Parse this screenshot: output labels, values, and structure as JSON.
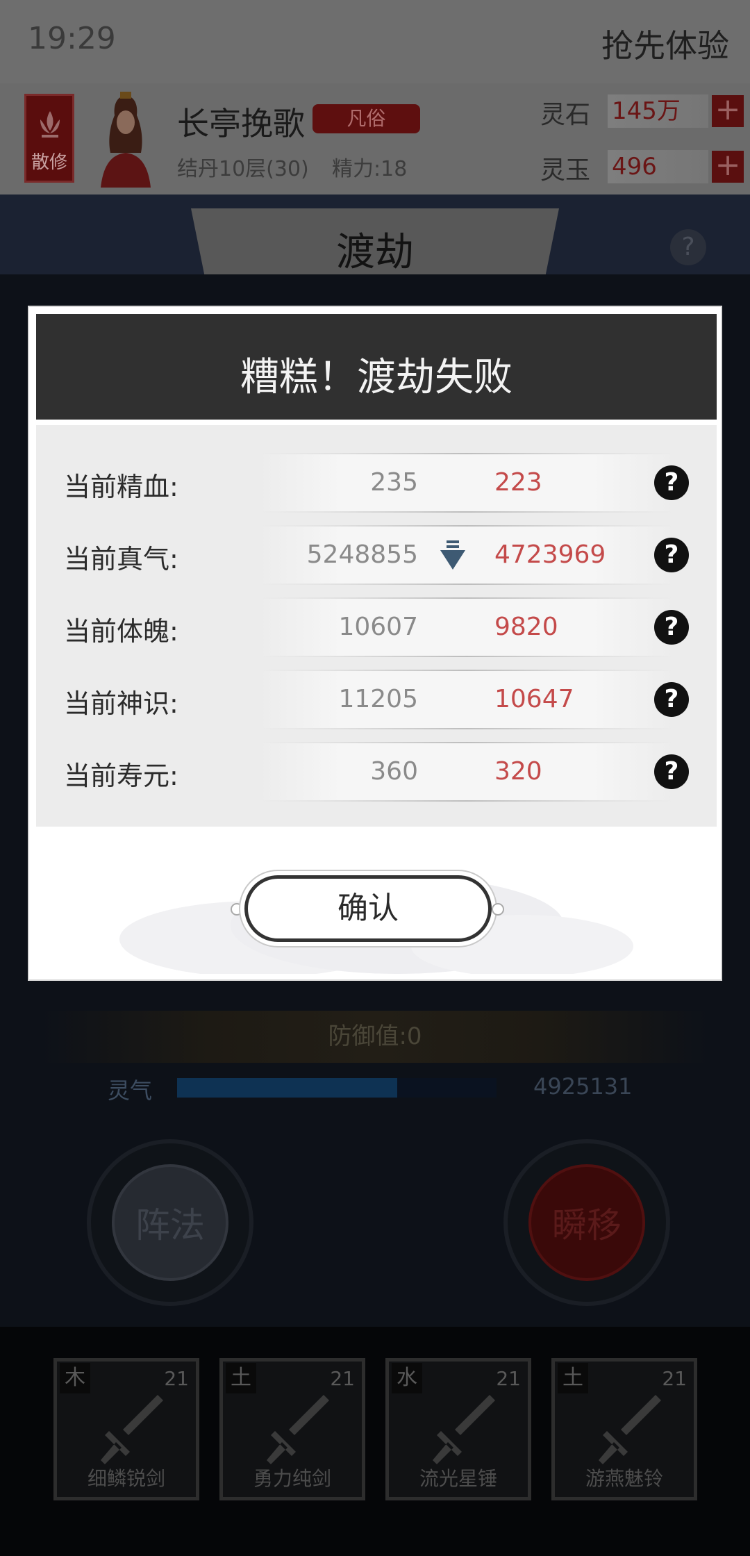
{
  "status_bar": {
    "time": "19:29",
    "early_access": "抢先体验"
  },
  "player": {
    "sect_label": "散修",
    "name": "长亭挽歌",
    "rank": "凡俗",
    "realm": "结丹10层(30)",
    "energy": "精力:18"
  },
  "resources": [
    {
      "label": "灵石",
      "value": "145万",
      "plus": "+"
    },
    {
      "label": "灵玉",
      "value": "496",
      "plus": "+"
    }
  ],
  "page": {
    "title": "渡劫",
    "help": "?"
  },
  "dialog": {
    "title": "糟糕！渡劫失败",
    "stats": [
      {
        "label": "当前精血:",
        "old": "235",
        "new": "223",
        "help": "?"
      },
      {
        "label": "当前真气:",
        "old": "5248855",
        "new": "4723969",
        "help": "?"
      },
      {
        "label": "当前体魄:",
        "old": "10607",
        "new": "9820",
        "help": "?"
      },
      {
        "label": "当前神识:",
        "old": "11205",
        "new": "10647",
        "help": "?"
      },
      {
        "label": "当前寿元:",
        "old": "360",
        "new": "320",
        "help": "?"
      }
    ],
    "confirm": "确认"
  },
  "battle": {
    "defense": "防御值:0",
    "qi_label": "灵气",
    "qi_value": "4925131",
    "qi_fill_fraction": 0.69,
    "skill_left": "阵法",
    "skill_right": "瞬移"
  },
  "items": [
    {
      "element": "木",
      "level": "21",
      "name": "细鳞锐剑"
    },
    {
      "element": "土",
      "level": "21",
      "name": "勇力纯剑"
    },
    {
      "element": "水",
      "level": "21",
      "name": "流光星锤"
    },
    {
      "element": "土",
      "level": "21",
      "name": "游燕魅铃"
    }
  ],
  "colors": {
    "accent_red": "#c44a4a",
    "modal_header": "#303030",
    "arrow_blue": "#3e5a73"
  }
}
